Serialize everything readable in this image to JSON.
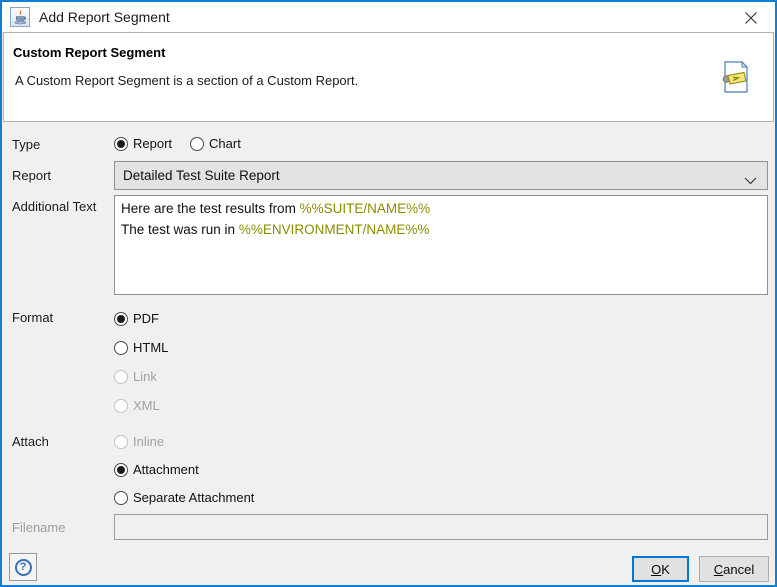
{
  "window": {
    "title": "Add Report Segment",
    "accent_color": "#0078d7",
    "app_icon": "java-cup-icon"
  },
  "header": {
    "title": "Custom Report Segment",
    "description": "A Custom Report Segment is a section of a Custom Report.",
    "icon": "report-segment-document-icon"
  },
  "form": {
    "type": {
      "label": "Type",
      "options": [
        {
          "label": "Report",
          "selected": true,
          "enabled": true
        },
        {
          "label": "Chart",
          "selected": false,
          "enabled": true
        }
      ]
    },
    "report": {
      "label": "Report",
      "value": "Detailed Test Suite Report"
    },
    "additional_text": {
      "label": "Additional Text",
      "variable_color": "#8b8b00",
      "lines": [
        {
          "segments": [
            {
              "text": "Here are the test results from ",
              "style": "plain"
            },
            {
              "text": "%%SUITE/NAME%%",
              "style": "variable"
            }
          ]
        },
        {
          "segments": [
            {
              "text": "The test was run in ",
              "style": "plain"
            },
            {
              "text": "%%ENVIRONMENT/NAME%%",
              "style": "variable"
            }
          ]
        }
      ]
    },
    "format": {
      "label": "Format",
      "options": [
        {
          "label": "PDF",
          "selected": true,
          "enabled": true
        },
        {
          "label": "HTML",
          "selected": false,
          "enabled": true
        },
        {
          "label": "Link",
          "selected": false,
          "enabled": false
        },
        {
          "label": "XML",
          "selected": false,
          "enabled": false
        }
      ]
    },
    "attach": {
      "label": "Attach",
      "options": [
        {
          "label": "Inline",
          "selected": false,
          "enabled": false
        },
        {
          "label": "Attachment",
          "selected": true,
          "enabled": true
        },
        {
          "label": "Separate Attachment",
          "selected": false,
          "enabled": true
        }
      ]
    },
    "filename": {
      "label": "Filename",
      "value": "",
      "enabled": false
    }
  },
  "footer": {
    "help_label": "?",
    "ok_label": "OK",
    "cancel_label": "Cancel"
  }
}
